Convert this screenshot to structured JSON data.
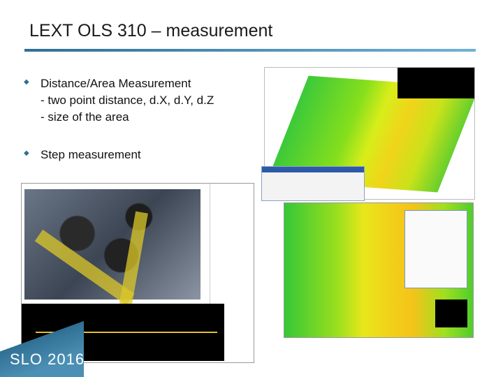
{
  "slide": {
    "title": "LEXT OLS 310 – measurement",
    "bullets": [
      {
        "lines": [
          "Distance/Area Measurement",
          "- two point distance, d.X, d.Y, d.Z",
          "- size of the area"
        ]
      },
      {
        "lines": [
          "Step measurement"
        ]
      }
    ],
    "footer": "SLO 2016"
  },
  "colors": {
    "accent": "#2f6f93",
    "bullet_marker": "#2f6f93"
  }
}
